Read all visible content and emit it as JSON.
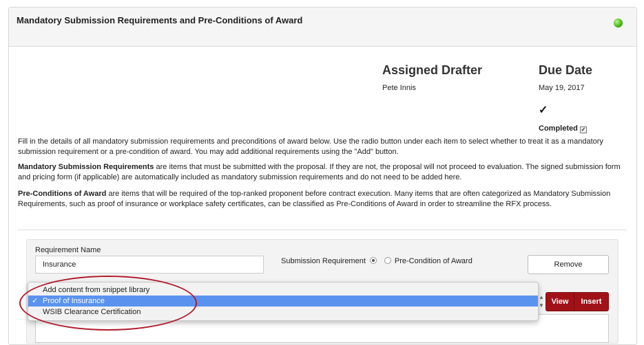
{
  "panel": {
    "title": "Mandatory Submission Requirements and Pre-Conditions of Award",
    "status_color": "#3fb50f"
  },
  "assignment": {
    "drafter_heading": "Assigned Drafter",
    "drafter_name": "Pete Innis",
    "due_heading": "Due Date",
    "due_date": "May 19, 2017",
    "check_glyph": "✓",
    "completed_label": "Completed",
    "completed_checked": true
  },
  "instructions": {
    "intro": "Fill in the details of all mandatory submission requirements and preconditions of award below. Use the radio button under each item to select whether to treat it as a mandatory submission requirement or a pre-condition of award. You may add additional requirements using the \"Add\" button.",
    "msr_term": "Mandatory Submission Requirements",
    "msr_text": " are items that must be submitted with the proposal. If they are not, the proposal will not proceed to evaluation. The signed submission form and pricing form (if applicable) are automatically included as mandatory submission requirements and do not need to be added here.",
    "pca_term": "Pre-Conditions of Award",
    "pca_text": " are items that will be required of the top-ranked proponent before contract execution. Many items that are often categorized as Mandatory Submission Requirements, such as proof of insurance or workplace safety certificates, can be classified as Pre-Conditions of Award in order to streamline the RFX process."
  },
  "requirement": {
    "name_label": "Requirement Name",
    "name_value": "Insurance",
    "radio_msr_label": "Submission Requirement",
    "radio_pca_label": "Pre-Condition of Award",
    "selected_type": "Submission Requirement",
    "remove_label": "Remove",
    "view_label": "View",
    "insert_label": "Insert",
    "accent_color": "#a11218"
  },
  "snippet_dropdown": {
    "options": [
      "Add content from snippet library",
      "Proof of Insurance",
      "WSIB Clearance Certification"
    ],
    "selected_index": 1,
    "check_glyph": "✓",
    "highlight_color": "#5a93ef",
    "annotation_color": "#b01c2c"
  }
}
